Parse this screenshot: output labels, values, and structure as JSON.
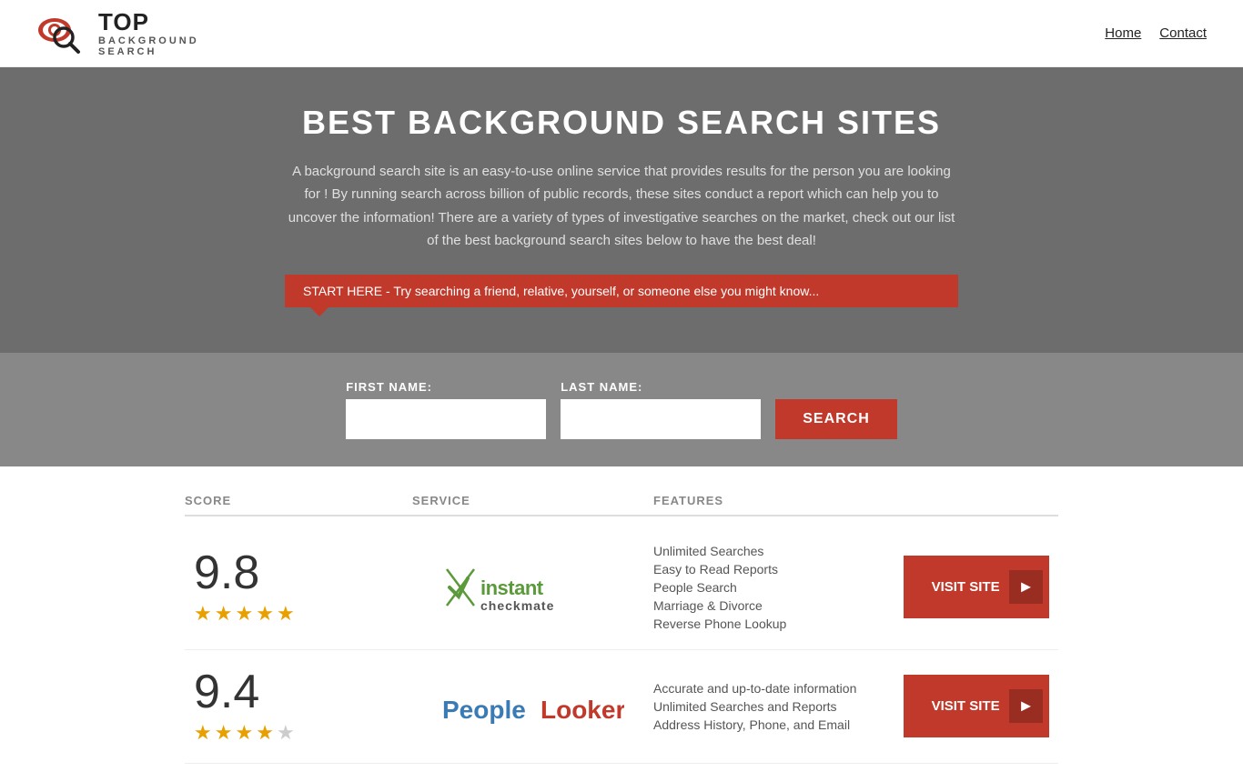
{
  "header": {
    "logo_top": "TOP",
    "logo_sub": "BACKGROUND\nSEARCH",
    "nav": [
      {
        "label": "Home",
        "href": "#"
      },
      {
        "label": "Contact",
        "href": "#"
      }
    ]
  },
  "hero": {
    "title": "BEST BACKGROUND SEARCH SITES",
    "description": "A background search site is an easy-to-use online service that provides results  for the person you are looking for ! By  running  search across billion of public records, these sites conduct  a report which can help you to uncover the information! There are a variety of types of investigative searches on the market, check out our  list of the best background search sites below to have the best deal!",
    "callout": "START HERE - Try searching a friend, relative, yourself, or someone else you might know..."
  },
  "search_form": {
    "first_name_label": "FIRST NAME:",
    "last_name_label": "LAST NAME:",
    "first_name_placeholder": "",
    "last_name_placeholder": "",
    "search_button": "SEARCH"
  },
  "table": {
    "headers": {
      "score": "SCORE",
      "service": "SERVICE",
      "features": "FEATURES",
      "action": ""
    },
    "rows": [
      {
        "score": "9.8",
        "stars": 4.5,
        "service_name": "Instant Checkmate",
        "service_type": "checkmate",
        "features": [
          "Unlimited Searches",
          "Easy to Read Reports",
          "People Search",
          "Marriage & Divorce",
          "Reverse Phone Lookup"
        ],
        "visit_label": "VISIT SITE"
      },
      {
        "score": "9.4",
        "stars": 4,
        "service_name": "PeopleLooker",
        "service_type": "peoplelooker",
        "features": [
          "Accurate and up-to-date information",
          "Unlimited Searches and Reports",
          "Address History, Phone, and Email"
        ],
        "visit_label": "VISIT SITE"
      }
    ]
  }
}
